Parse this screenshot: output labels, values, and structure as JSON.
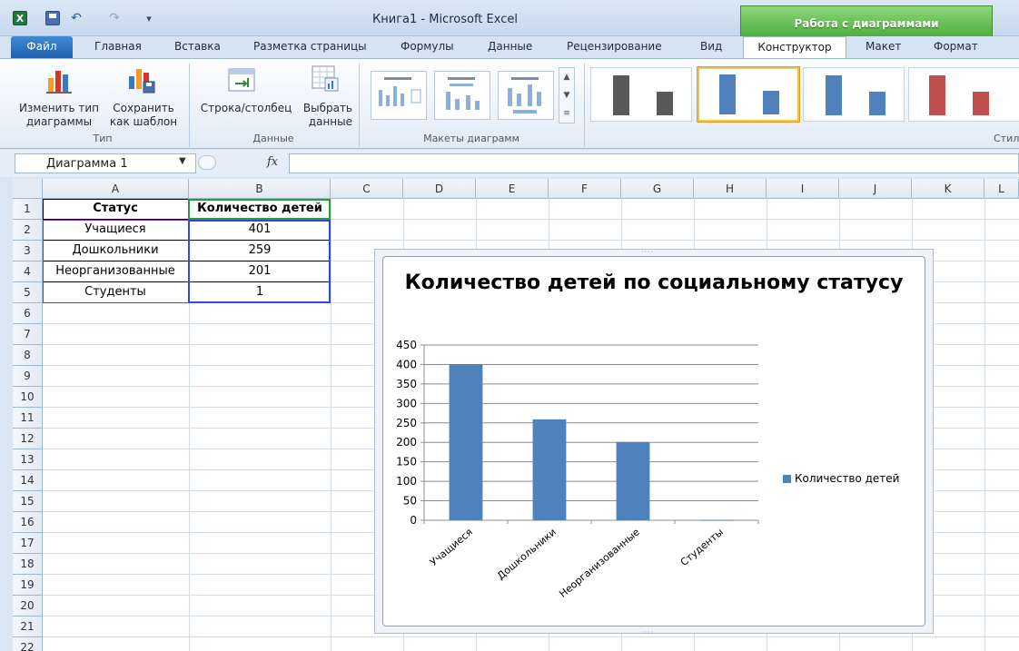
{
  "window": {
    "title": "Книга1  -  Microsoft Excel",
    "context_tab_title": "Работа с диаграммами"
  },
  "icons": {
    "excel_glyph": "X",
    "undo_glyph": "↶",
    "redo_glyph": "↷",
    "more_glyph": "▾",
    "fx_glyph": "fx",
    "dropdown_glyph": "▼"
  },
  "tabs": [
    {
      "label": "Файл"
    },
    {
      "label": "Главная"
    },
    {
      "label": "Вставка"
    },
    {
      "label": "Разметка страницы"
    },
    {
      "label": "Формулы"
    },
    {
      "label": "Данные"
    },
    {
      "label": "Рецензирование"
    },
    {
      "label": "Вид"
    },
    {
      "label": "Конструктор"
    },
    {
      "label": "Макет"
    },
    {
      "label": "Формат"
    }
  ],
  "ribbon": {
    "type_group": {
      "label": "Тип",
      "change_type": "Изменить тип\nдиаграммы",
      "save_template": "Сохранить\nкак шаблон"
    },
    "data_group": {
      "label": "Данные",
      "row_col": "Строка/столбец",
      "select_data": "Выбрать\nданные"
    },
    "layouts_group": {
      "label": "Макеты диаграмм"
    },
    "styles_group": {
      "label": "Стили д"
    },
    "style_colors": [
      "#595959",
      "#4f81bd",
      "#4f81bd",
      "#c0504d"
    ]
  },
  "formula_bar": {
    "name_box": "Диаграмма 1",
    "formula": ""
  },
  "sheet": {
    "columns": [
      "A",
      "B",
      "C",
      "D",
      "E",
      "F",
      "G",
      "H",
      "I",
      "J",
      "K",
      "L"
    ],
    "rows": [
      "1",
      "2",
      "3",
      "4",
      "5",
      "6",
      "7",
      "8",
      "9",
      "10",
      "11",
      "12",
      "13",
      "14",
      "15",
      "16",
      "17",
      "18",
      "19",
      "20",
      "21",
      "22"
    ],
    "header": [
      "Статус",
      "Количество детей"
    ],
    "data": [
      [
        "Учащиеся",
        "401"
      ],
      [
        "Дошкольники",
        "259"
      ],
      [
        "Неорганизованные",
        "201"
      ],
      [
        "Студенты",
        "1"
      ]
    ]
  },
  "chart_data": {
    "type": "bar",
    "title": "Количество детей по социальному статусу",
    "categories": [
      "Учащиеся",
      "Дошкольники",
      "Неорганизованные",
      "Студенты"
    ],
    "series": [
      {
        "name": "Количество детей",
        "values": [
          401,
          259,
          201,
          1
        ],
        "color": "#4f81bd"
      }
    ],
    "ylim": [
      0,
      450
    ],
    "yticks": [
      0,
      50,
      100,
      150,
      200,
      250,
      300,
      350,
      400,
      450
    ],
    "grid": true,
    "legend": "right"
  }
}
